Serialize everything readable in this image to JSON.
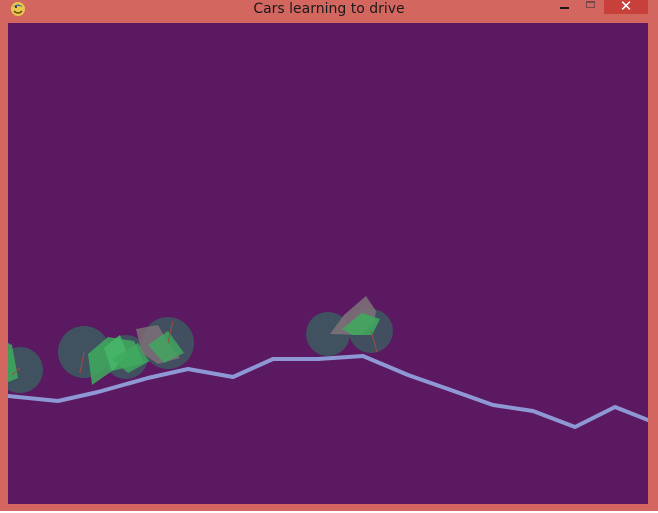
{
  "window": {
    "title": "Cars learning to drive",
    "icon": "python-snake-icon",
    "controls": {
      "minimize": "minimize-icon",
      "maximize": "maximize-icon",
      "close_glyph": "✕"
    },
    "colors": {
      "frame": "#d3665e",
      "close_button": "#c7403a",
      "canvas_background": "#5a1960",
      "terrain_line": "#8e98d4",
      "wheel": "#3f5560",
      "car_body_green": "#3faa5e",
      "car_body_grey": "#7c7078"
    }
  },
  "scene": {
    "description_type": "side-view physics simulation",
    "car_count": 6
  }
}
